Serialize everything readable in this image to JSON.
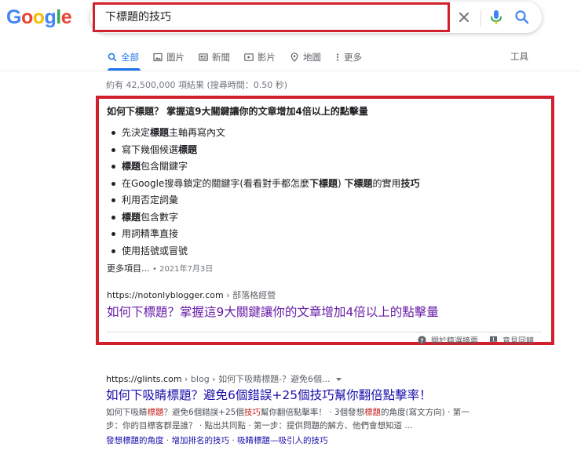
{
  "logo": "Google",
  "search": {
    "query": "下標題的技巧"
  },
  "tabs": [
    {
      "label": "全部",
      "icon": "search-icon",
      "active": true
    },
    {
      "label": "圖片",
      "icon": "image-icon"
    },
    {
      "label": "新聞",
      "icon": "news-icon"
    },
    {
      "label": "影片",
      "icon": "video-icon"
    },
    {
      "label": "地圖",
      "icon": "map-pin-icon"
    },
    {
      "label": "更多",
      "icon": "more-vert-icon"
    }
  ],
  "tools_label": "工具",
  "stats": "約有 42,500,000 項結果 (搜尋時間：0.50 秒)",
  "featured": {
    "heading": "如何下標題？ 掌握這9大關鍵讓你的文章增加4倍以上的點擊量",
    "bullets": [
      [
        {
          "t": "先決定"
        },
        {
          "t": "標題",
          "b": true
        },
        {
          "t": "主軸再寫內文"
        }
      ],
      [
        {
          "t": "寫下幾個候選"
        },
        {
          "t": "標題",
          "b": true
        }
      ],
      [
        {
          "t": "標題",
          "b": true
        },
        {
          "t": "包含關鍵字"
        }
      ],
      [
        {
          "t": "在Google搜尋鎖定的關鍵字(看看對手都怎麼"
        },
        {
          "t": "下標題",
          "b": true
        },
        {
          "t": ") "
        },
        {
          "t": "下標題",
          "b": true
        },
        {
          "t": "的實用"
        },
        {
          "t": "技巧",
          "b": true
        }
      ],
      [
        {
          "t": "利用否定詞彙"
        }
      ],
      [
        {
          "t": "標題",
          "b": true
        },
        {
          "t": "包含數字"
        }
      ],
      [
        {
          "t": "用詞精準直接"
        }
      ],
      [
        {
          "t": "使用括號或冒號"
        }
      ]
    ],
    "more_label": "更多項目...",
    "date": "2021年7月3日",
    "url": "https://notonlyblogger.com",
    "breadcrumb": "› 部落格經營",
    "link_title": "如何下標題？掌握這9大關鍵讓你的文章增加4倍以上的點擊量",
    "about_label": "關於精選摘要",
    "feedback_label": "意見回饋"
  },
  "result2": {
    "url": "https://glints.com",
    "breadcrumb": "› blog › 如何下吸睛標題-？避免6個...",
    "title": "如何下吸睛標題？避免6個錯誤+25個技巧幫你翻倍點擊率！",
    "desc": [
      {
        "t": "如何下吸睛"
      },
      {
        "t": "標題",
        "hl": true
      },
      {
        "t": "？避免6個錯誤+25個"
      },
      {
        "t": "技巧",
        "hl": true
      },
      {
        "t": "幫你翻倍點擊率！ · 3個發想"
      },
      {
        "t": "標題",
        "hl": true
      },
      {
        "t": "的角度(寫文方向) · 第一步：你的目標客群是誰？ · 點出共同點 · 第一步：提供問題的解方、他們會想知道 ..."
      }
    ],
    "sitelinks": [
      "發想標題的角度",
      "增加排名的技巧",
      "吸睛標題—吸引人的技巧"
    ]
  }
}
